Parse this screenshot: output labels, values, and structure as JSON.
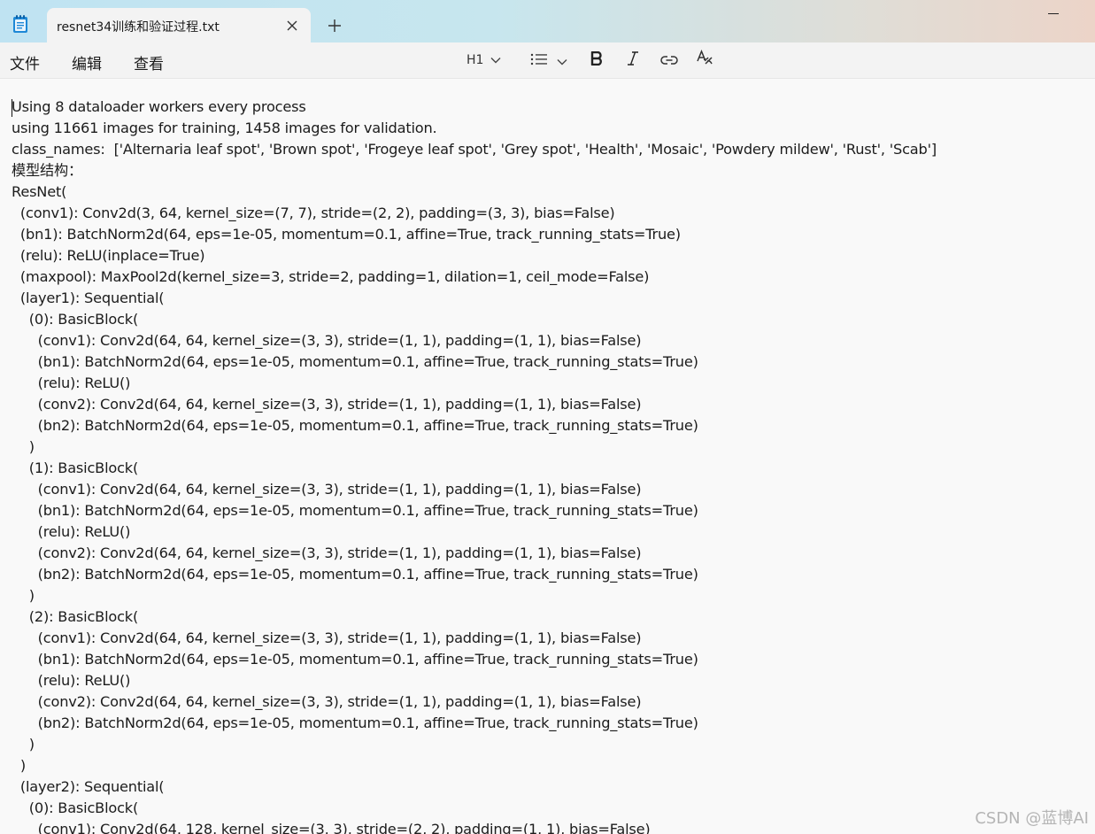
{
  "window": {
    "tab_title": "resnet34训练和验证过程.txt",
    "new_tab_label": "+"
  },
  "menu": [
    "文件",
    "编辑",
    "查看"
  ],
  "toolbar": {
    "heading_label": "H1"
  },
  "icons": {
    "app": "notepad-icon",
    "close": "close-icon",
    "new_tab": "plus-icon",
    "minimize": "minimize-icon",
    "heading_dropdown": "chevron-down-icon",
    "list": "bulleted-list-icon",
    "bold": "bold-icon",
    "italic": "italic-icon",
    "link": "link-icon",
    "spellcheck": "spellcheck-icon"
  },
  "document": {
    "lines": [
      "Using 8 dataloader workers every process",
      "using 11661 images for training, 1458 images for validation.",
      "class_names:  ['Alternaria leaf spot', 'Brown spot', 'Frogeye leaf spot', 'Grey spot', 'Health', 'Mosaic', 'Powdery mildew', 'Rust', 'Scab']",
      "模型结构：",
      "ResNet(",
      "  (conv1): Conv2d(3, 64, kernel_size=(7, 7), stride=(2, 2), padding=(3, 3), bias=False)",
      "  (bn1): BatchNorm2d(64, eps=1e-05, momentum=0.1, affine=True, track_running_stats=True)",
      "  (relu): ReLU(inplace=True)",
      "  (maxpool): MaxPool2d(kernel_size=3, stride=2, padding=1, dilation=1, ceil_mode=False)",
      "  (layer1): Sequential(",
      "    (0): BasicBlock(",
      "      (conv1): Conv2d(64, 64, kernel_size=(3, 3), stride=(1, 1), padding=(1, 1), bias=False)",
      "      (bn1): BatchNorm2d(64, eps=1e-05, momentum=0.1, affine=True, track_running_stats=True)",
      "      (relu): ReLU()",
      "      (conv2): Conv2d(64, 64, kernel_size=(3, 3), stride=(1, 1), padding=(1, 1), bias=False)",
      "      (bn2): BatchNorm2d(64, eps=1e-05, momentum=0.1, affine=True, track_running_stats=True)",
      "    )",
      "    (1): BasicBlock(",
      "      (conv1): Conv2d(64, 64, kernel_size=(3, 3), stride=(1, 1), padding=(1, 1), bias=False)",
      "      (bn1): BatchNorm2d(64, eps=1e-05, momentum=0.1, affine=True, track_running_stats=True)",
      "      (relu): ReLU()",
      "      (conv2): Conv2d(64, 64, kernel_size=(3, 3), stride=(1, 1), padding=(1, 1), bias=False)",
      "      (bn2): BatchNorm2d(64, eps=1e-05, momentum=0.1, affine=True, track_running_stats=True)",
      "    )",
      "    (2): BasicBlock(",
      "      (conv1): Conv2d(64, 64, kernel_size=(3, 3), stride=(1, 1), padding=(1, 1), bias=False)",
      "      (bn1): BatchNorm2d(64, eps=1e-05, momentum=0.1, affine=True, track_running_stats=True)",
      "      (relu): ReLU()",
      "      (conv2): Conv2d(64, 64, kernel_size=(3, 3), stride=(1, 1), padding=(1, 1), bias=False)",
      "      (bn2): BatchNorm2d(64, eps=1e-05, momentum=0.1, affine=True, track_running_stats=True)",
      "    )",
      "  )",
      "  (layer2): Sequential(",
      "    (0): BasicBlock(",
      "      (conv1): Conv2d(64, 128, kernel_size=(3, 3), stride=(2, 2), padding=(1, 1), bias=False)"
    ]
  },
  "watermark": "CSDN @蓝博AI",
  "colors": {
    "titlebar_gradient_start": "#bfe3f2",
    "titlebar_gradient_end": "#ecd4c8",
    "tab_bg": "#f3f3f3",
    "editor_bg": "#f9f9f9",
    "text": "#1c1c1c"
  }
}
